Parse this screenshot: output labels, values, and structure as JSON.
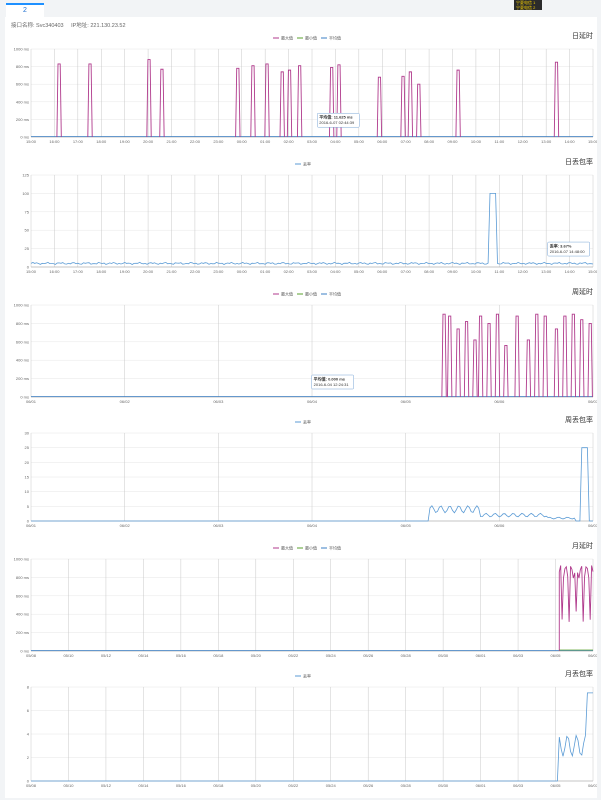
{
  "tab": {
    "label": "2"
  },
  "badge": {
    "line1": "宁夏电信 1",
    "line2": "宁夏电信 2"
  },
  "info": {
    "interface": "接口名称: Svc340403",
    "ip": "IP地址: 221.130.23.52"
  },
  "colors": {
    "max": "#b03a8c",
    "min": "#5aa02c",
    "avg": "#3b7fc4",
    "loss": "#5b9bd5"
  },
  "legend": {
    "max": "最大值",
    "min": "最小值",
    "avg": "平均值",
    "loss": "丢率"
  },
  "charts": [
    {
      "id": "day_latency",
      "title": "日延时",
      "type": "latency",
      "yticks": [
        "0 ms",
        "200 ms",
        "400 ms",
        "600 ms",
        "800 ms",
        "1000 ms"
      ],
      "ymax": 1000,
      "xticks": [
        "15:00",
        "16:00",
        "17:00",
        "18:00",
        "19:00",
        "20:00",
        "21:00",
        "22:00",
        "23:00",
        "00:00",
        "01:00",
        "02:00",
        "03:00",
        "04:00",
        "05:00",
        "06:00",
        "07:00",
        "08:00",
        "09:00",
        "10:00",
        "11:00",
        "12:00",
        "13:00",
        "14:00",
        "15:00"
      ],
      "spikes": [
        {
          "x": 0.05,
          "v": 830
        },
        {
          "x": 0.105,
          "v": 830
        },
        {
          "x": 0.21,
          "v": 880
        },
        {
          "x": 0.233,
          "v": 770
        },
        {
          "x": 0.368,
          "v": 780
        },
        {
          "x": 0.395,
          "v": 810
        },
        {
          "x": 0.42,
          "v": 830
        },
        {
          "x": 0.447,
          "v": 740
        },
        {
          "x": 0.46,
          "v": 760
        },
        {
          "x": 0.478,
          "v": 810
        },
        {
          "x": 0.535,
          "v": 790
        },
        {
          "x": 0.548,
          "v": 820
        },
        {
          "x": 0.62,
          "v": 680
        },
        {
          "x": 0.662,
          "v": 690
        },
        {
          "x": 0.675,
          "v": 740
        },
        {
          "x": 0.69,
          "v": 600
        },
        {
          "x": 0.76,
          "v": 760
        },
        {
          "x": 0.935,
          "v": 850
        }
      ],
      "tooltip": {
        "title": "平均值: 11.625 ms",
        "date": "2016-6-07 02:44:39",
        "x": 0.545,
        "v": 20
      }
    },
    {
      "id": "day_loss",
      "title": "日丢包率",
      "type": "loss",
      "yticks": [
        "0",
        "25",
        "50",
        "75",
        "100",
        "125"
      ],
      "ymax": 125,
      "xticks": [
        "15:00",
        "16:00",
        "17:00",
        "18:00",
        "19:00",
        "20:00",
        "21:00",
        "22:00",
        "23:00",
        "00:00",
        "01:00",
        "02:00",
        "03:00",
        "04:00",
        "05:00",
        "06:00",
        "07:00",
        "08:00",
        "09:00",
        "10:00",
        "11:00",
        "12:00",
        "13:00",
        "14:00",
        "15:00"
      ],
      "base": 4,
      "noise": 3,
      "spikes": [
        {
          "x": 0.822,
          "v": 100
        }
      ],
      "tooltip": {
        "title": "丢率: 3.67%",
        "date": "2016-6-07 14:48:00",
        "x": 0.955,
        "v": 4
      }
    },
    {
      "id": "week_latency",
      "title": "周延时",
      "type": "latency",
      "yticks": [
        "0 ms",
        "200 ms",
        "400 ms",
        "600 ms",
        "800 ms",
        "1000 ms"
      ],
      "ymax": 1000,
      "xticks": [
        "06/01",
        "06/02",
        "06/03",
        "06/04",
        "06/05",
        "06/06",
        "06/07"
      ],
      "spikes": [
        {
          "x": 0.735,
          "v": 900
        },
        {
          "x": 0.745,
          "v": 880
        },
        {
          "x": 0.76,
          "v": 740
        },
        {
          "x": 0.775,
          "v": 820
        },
        {
          "x": 0.79,
          "v": 620
        },
        {
          "x": 0.8,
          "v": 880
        },
        {
          "x": 0.815,
          "v": 800
        },
        {
          "x": 0.83,
          "v": 900
        },
        {
          "x": 0.845,
          "v": 560
        },
        {
          "x": 0.865,
          "v": 880
        },
        {
          "x": 0.885,
          "v": 620
        },
        {
          "x": 0.9,
          "v": 900
        },
        {
          "x": 0.915,
          "v": 880
        },
        {
          "x": 0.935,
          "v": 740
        },
        {
          "x": 0.95,
          "v": 880
        },
        {
          "x": 0.965,
          "v": 900
        },
        {
          "x": 0.98,
          "v": 840
        },
        {
          "x": 0.995,
          "v": 800
        }
      ],
      "tooltip": {
        "title": "平均值: 0.000 ms",
        "date": "2016-6-04 12:24:31",
        "x": 0.535,
        "v": 0
      }
    },
    {
      "id": "week_loss",
      "title": "周丢包率",
      "type": "loss",
      "yticks": [
        "0",
        "5",
        "10",
        "15",
        "20",
        "25",
        "30"
      ],
      "ymax": 30,
      "xticks": [
        "06/01",
        "06/02",
        "06/03",
        "06/04",
        "06/05",
        "06/06",
        "06/07"
      ],
      "base": 0,
      "noise": 0,
      "segments": [
        {
          "from": 0.71,
          "to": 0.8,
          "v": 4
        },
        {
          "from": 0.8,
          "to": 0.92,
          "v": 2
        },
        {
          "from": 0.92,
          "to": 0.97,
          "v": 1
        }
      ],
      "spikes": [
        {
          "x": 0.985,
          "v": 25
        }
      ],
      "tooltip": null
    },
    {
      "id": "month_latency",
      "title": "月延时",
      "type": "latency",
      "yticks": [
        "0 ms",
        "200 ms",
        "400 ms",
        "600 ms",
        "800 ms",
        "1000 ms"
      ],
      "ymax": 1000,
      "xticks": [
        "05/08",
        "05/10",
        "05/12",
        "05/14",
        "05/16",
        "05/18",
        "05/20",
        "05/22",
        "05/24",
        "05/26",
        "05/28",
        "05/30",
        "06/01",
        "06/03",
        "06/05",
        "06/07"
      ],
      "block": {
        "from": 0.94,
        "to": 1.0,
        "v": 860
      },
      "spikes": [],
      "tooltip": null
    },
    {
      "id": "month_loss",
      "title": "月丢包率",
      "type": "loss",
      "yticks": [
        "0",
        "2",
        "4",
        "6",
        "8"
      ],
      "ymax": 8,
      "xticks": [
        "05/08",
        "05/10",
        "05/12",
        "05/14",
        "05/16",
        "05/18",
        "05/20",
        "05/22",
        "05/24",
        "05/26",
        "05/28",
        "05/30",
        "06/01",
        "06/03",
        "06/05",
        "06/07"
      ],
      "base": 0,
      "noise": 0,
      "segments": [
        {
          "from": 0.94,
          "to": 1.0,
          "v": 3
        }
      ],
      "spikes": [
        {
          "x": 0.995,
          "v": 7.5
        }
      ],
      "tooltip": null
    }
  ]
}
